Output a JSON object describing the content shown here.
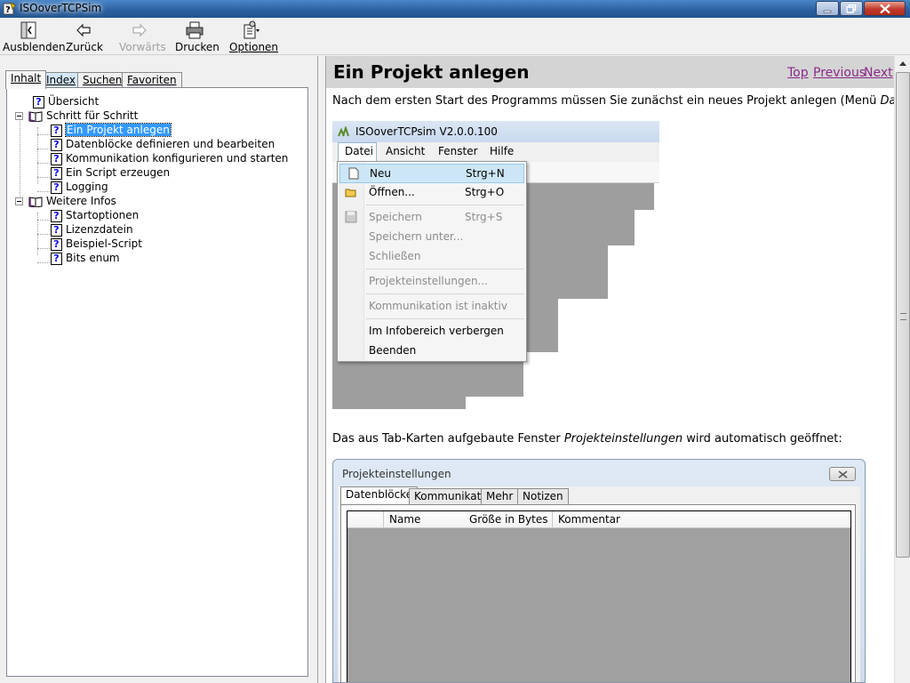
{
  "window": {
    "title": "ISOoverTCPSim"
  },
  "toolbar": {
    "hide": "Ausblenden",
    "back": "Zurück",
    "forward": "Vorwärts",
    "print": "Drucken",
    "options": "Optionen"
  },
  "tabs": [
    "Inhalt",
    "Index",
    "Suchen",
    "Favoriten"
  ],
  "tree": {
    "overview": "Übersicht",
    "step_by_step": "Schritt für Schritt",
    "create_project": "Ein Projekt anlegen",
    "datablocks": "Datenblöcke definieren und bearbeiten",
    "communication": "Kommunikation konfigurieren und starten",
    "script": "Ein Script erzeugen",
    "logging": "Logging",
    "more_info": "Weitere Infos",
    "startoptions": "Startoptionen",
    "license": "Lizenzdatein",
    "example_script": "Beispiel-Script",
    "bits_enum": "Bits enum"
  },
  "content": {
    "title": "Ein Projekt anlegen",
    "nav": {
      "top": "Top",
      "previous": "Previous",
      "next": "Next"
    },
    "para1_a": "Nach dem ersten Start des Programms müssen Sie zunächst ein neues Projekt anlegen (Menü ",
    "para1_b": "Datei>Neu",
    "para1_c": "):",
    "para2_a": "Das aus Tab-Karten aufgebaute Fenster ",
    "para2_b": "Projekteinstellungen",
    "para2_c": " wird automatisch geöffnet:"
  },
  "shot1": {
    "title": "ISOoverTCPsim V2.0.0.100",
    "menubar": [
      "Datei",
      "Ansicht",
      "Fenster",
      "Hilfe"
    ],
    "menu": {
      "new": "Neu",
      "new_sc": "Strg+N",
      "open": "Öffnen...",
      "open_sc": "Strg+O",
      "save": "Speichern",
      "save_sc": "Strg+S",
      "save_as": "Speichern unter...",
      "close": "Schließen",
      "settings": "Projekteinstellungen...",
      "comm": "Kommunikation ist inaktiv",
      "hide": "Im Infobereich verbergen",
      "exit": "Beenden"
    }
  },
  "shot2": {
    "title": "Projekteinstellungen",
    "tabs": [
      "Datenblöcke",
      "Kommunikation",
      "Mehr",
      "Notizen"
    ],
    "columns": [
      "Name",
      "Größe in Bytes",
      "Kommentar"
    ]
  }
}
